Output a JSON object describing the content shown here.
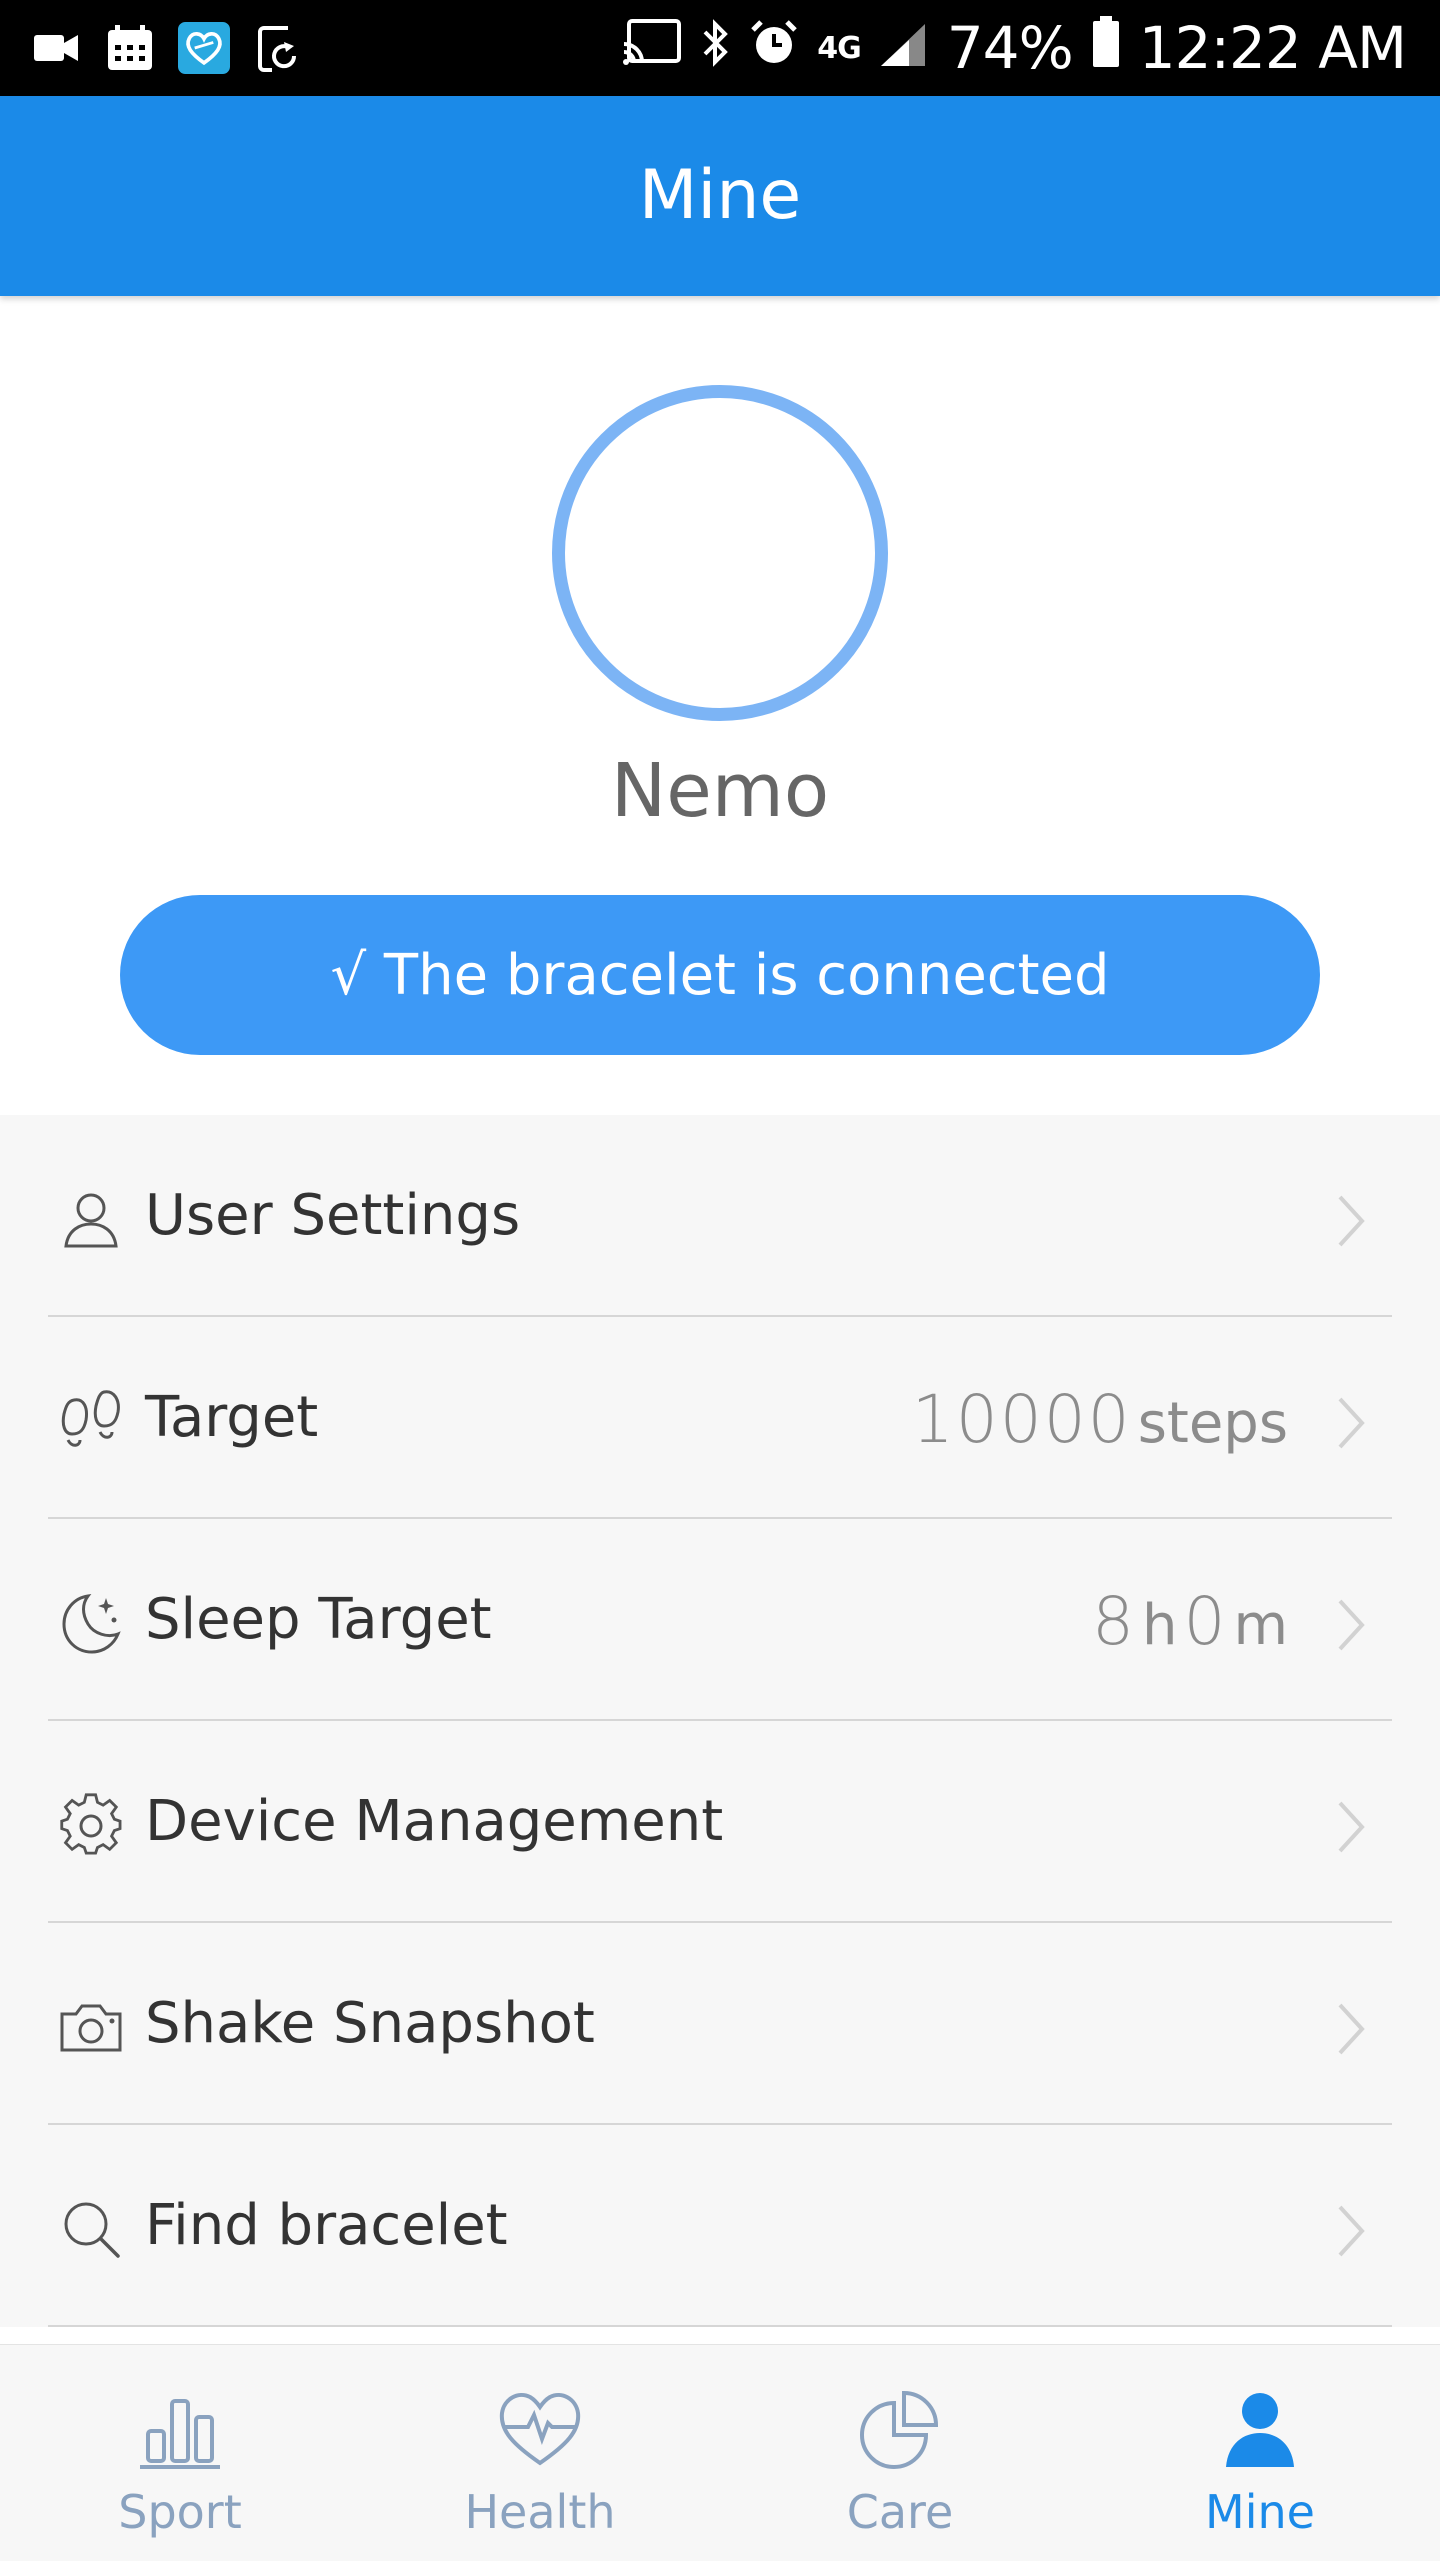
{
  "status_bar": {
    "battery": "74%",
    "time": "12:22 AM",
    "network": "4G"
  },
  "header": {
    "title": "Mine"
  },
  "profile": {
    "name": "Nemo",
    "connection_label": "√ The bracelet is connected"
  },
  "menu": [
    {
      "label": "User Settings",
      "icon": "user-icon"
    },
    {
      "label": "Target",
      "icon": "footprints-icon",
      "value": "10000",
      "unit": "steps"
    },
    {
      "label": "Sleep Target",
      "icon": "moon-icon",
      "value_h": "8",
      "unit_h": "h",
      "value_m": "0",
      "unit_m": "m"
    },
    {
      "label": "Device Management",
      "icon": "gear-icon"
    },
    {
      "label": "Shake Snapshot",
      "icon": "camera-icon"
    },
    {
      "label": "Find bracelet",
      "icon": "search-icon"
    }
  ],
  "tabs": [
    {
      "label": "Sport",
      "icon": "bar-chart-icon",
      "active": false
    },
    {
      "label": "Health",
      "icon": "heart-pulse-icon",
      "active": false
    },
    {
      "label": "Care",
      "icon": "pie-chart-icon",
      "active": false
    },
    {
      "label": "Mine",
      "icon": "person-icon",
      "active": true
    }
  ],
  "colors": {
    "header_blue": "#1b8ae8",
    "button_blue": "#3d99f6",
    "avatar_ring": "#7cb4f5",
    "inactive_tab": "#8aa2bf"
  }
}
